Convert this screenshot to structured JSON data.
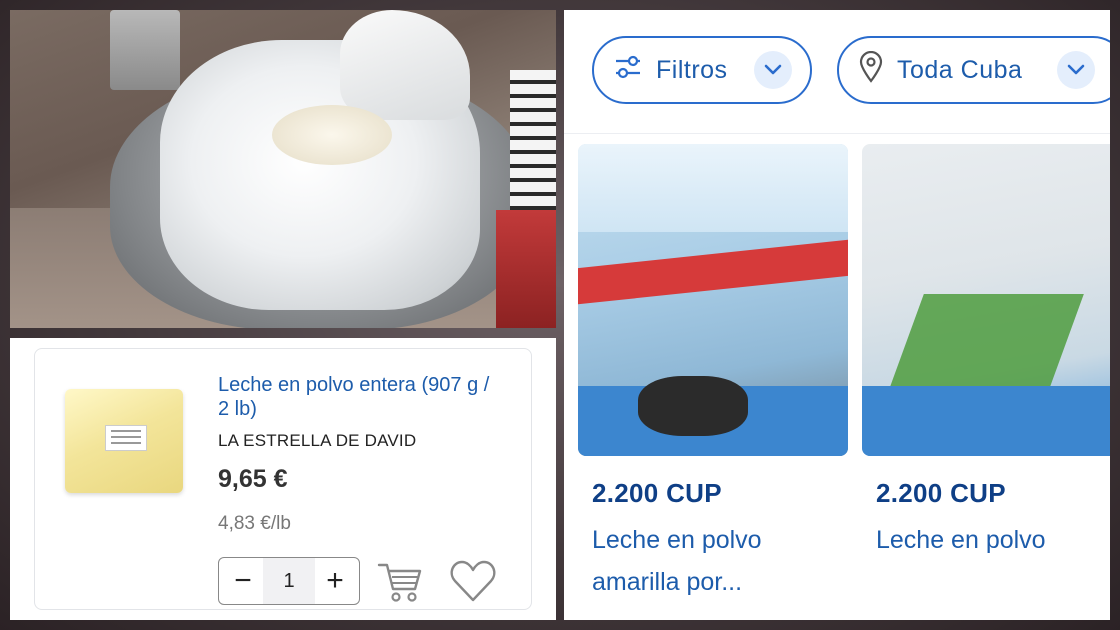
{
  "left_product": {
    "title": "Leche en polvo entera (907 g / 2 lb)",
    "store": "LA ESTRELLA DE DAVID",
    "price": "9,65 €",
    "unit_price": "4,83 €/lb",
    "quantity": "1",
    "minus": "−",
    "plus": "+",
    "icons": {
      "cart": "cart-icon",
      "favorite": "heart-icon"
    }
  },
  "filters": {
    "filter_label": "Filtros",
    "location_label": "Toda Cuba"
  },
  "listings": [
    {
      "price": "2.200 CUP",
      "title": "Leche en polvo amarilla por..."
    },
    {
      "price": "2.200 CUP",
      "title": "Leche en polvo"
    }
  ],
  "colors": {
    "accent": "#1d5cab",
    "price_dark": "#0f3f86"
  }
}
